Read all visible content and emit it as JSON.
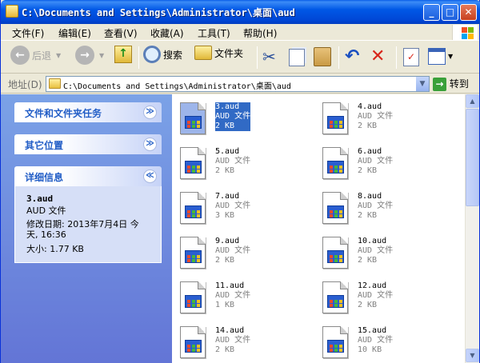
{
  "window": {
    "title": "C:\\Documents and Settings\\Administrator\\桌面\\aud",
    "controls": {
      "minimize": "_",
      "maximize": "□",
      "close": "✕"
    }
  },
  "menubar": {
    "items": [
      "文件(F)",
      "编辑(E)",
      "查看(V)",
      "收藏(A)",
      "工具(T)",
      "帮助(H)"
    ]
  },
  "toolbar": {
    "back_label": "后退",
    "search_label": "搜索",
    "folders_label": "文件夹"
  },
  "addressbar": {
    "label": "地址(D)",
    "value": "C:\\Documents and Settings\\Administrator\\桌面\\aud",
    "go_label": "转到"
  },
  "taskpane": {
    "panels": [
      {
        "title": "文件和文件夹任务",
        "chevron": "≫"
      },
      {
        "title": "其它位置",
        "chevron": "≫"
      },
      {
        "title": "详细信息",
        "chevron": "≪"
      }
    ],
    "details": {
      "name": "3.aud",
      "type": "AUD 文件",
      "modified_line1": "修改日期: 2013年7月4日 今",
      "modified_line2": "天, 16:36",
      "size": "大小: 1.77 KB"
    }
  },
  "files": [
    {
      "name": "3.aud",
      "type": "AUD 文件",
      "size": "2 KB",
      "selected": true
    },
    {
      "name": "4.aud",
      "type": "AUD 文件",
      "size": "2 KB"
    },
    {
      "name": "5.aud",
      "type": "AUD 文件",
      "size": "2 KB"
    },
    {
      "name": "6.aud",
      "type": "AUD 文件",
      "size": "2 KB"
    },
    {
      "name": "7.aud",
      "type": "AUD 文件",
      "size": "3 KB"
    },
    {
      "name": "8.aud",
      "type": "AUD 文件",
      "size": "2 KB"
    },
    {
      "name": "9.aud",
      "type": "AUD 文件",
      "size": "2 KB"
    },
    {
      "name": "10.aud",
      "type": "AUD 文件",
      "size": "2 KB"
    },
    {
      "name": "11.aud",
      "type": "AUD 文件",
      "size": "1 KB"
    },
    {
      "name": "12.aud",
      "type": "AUD 文件",
      "size": "2 KB"
    },
    {
      "name": "14.aud",
      "type": "AUD 文件",
      "size": "2 KB"
    },
    {
      "name": "15.aud",
      "type": "AUD 文件",
      "size": "10 KB"
    }
  ],
  "colors": {
    "titlebar": "#0058e6",
    "taskpane": "#7ba2e7",
    "selection": "#316ac5",
    "panel_title": "#215dc6"
  }
}
